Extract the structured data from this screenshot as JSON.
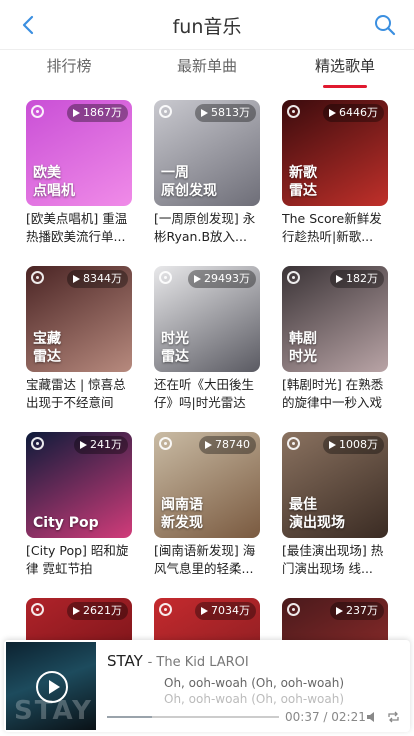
{
  "header": {
    "title": "fun音乐",
    "back_icon": "back-arrow-icon",
    "search_icon": "search-icon",
    "accent": "#3b8fe0"
  },
  "tabs": [
    {
      "label": "排行榜",
      "active": false
    },
    {
      "label": "最新单曲",
      "active": false
    },
    {
      "label": "精选歌单",
      "active": true
    }
  ],
  "accent_color": "#e0192f",
  "playlists": [
    {
      "plays": "1867万",
      "overlay": "欧美\n点唱机",
      "caption": "[欧美点唱机] 重温热播欧美流行单...",
      "colors": [
        "#c94fd6",
        "#f08be8"
      ]
    },
    {
      "plays": "5813万",
      "overlay": "一周\n原创发现",
      "caption": "[一周原创发现] 永彬Ryan.B放入...",
      "colors": [
        "#c9c9cf",
        "#6e6e78"
      ]
    },
    {
      "plays": "6446万",
      "overlay": "新歌\n雷达",
      "caption": "The Score新鲜发行趁热听|新歌...",
      "colors": [
        "#3a0b0d",
        "#c0302a"
      ]
    },
    {
      "plays": "8344万",
      "overlay": "宝藏\n雷达",
      "caption": "宝藏雷达 | 惊喜总出现于不经意间",
      "colors": [
        "#4a2424",
        "#b78a7e"
      ]
    },
    {
      "plays": "29493万",
      "overlay": "时光\n雷达",
      "caption": "还在听《大田後生仔》吗|时光雷达",
      "colors": [
        "#e8e8ea",
        "#5a5a62"
      ]
    },
    {
      "plays": "182万",
      "overlay": "韩剧\n时光",
      "caption": "[韩剧时光] 在熟悉的旋律中一秒入戏",
      "colors": [
        "#3a3336",
        "#b9a4a6"
      ]
    },
    {
      "plays": "241万",
      "overlay": "City Pop",
      "caption": "[City Pop] 昭和旋律 霓虹节拍",
      "colors": [
        "#0d1b3a",
        "#d13c7a"
      ]
    },
    {
      "plays": "78740",
      "overlay": "闽南语\n新发现",
      "caption": "[闽南语新发现] 海风气息里的轻柔...",
      "colors": [
        "#c9bba4",
        "#7a5a40"
      ]
    },
    {
      "plays": "1008万",
      "overlay": "最佳\n演出现场",
      "caption": "[最佳演出现场] 热门演出现场 线...",
      "colors": [
        "#8a7260",
        "#3a2b23"
      ]
    },
    {
      "plays": "2621万",
      "overlay": "",
      "caption": "",
      "colors": [
        "#b0232a",
        "#6a1014"
      ]
    },
    {
      "plays": "7034万",
      "overlay": "",
      "caption": "",
      "colors": [
        "#c52a2e",
        "#7a1a1e"
      ]
    },
    {
      "plays": "237万",
      "overlay": "",
      "caption": "",
      "colors": [
        "#4a1a1c",
        "#a0302e"
      ]
    }
  ],
  "player": {
    "song": "STAY",
    "artist": "- The Kid LAROI",
    "lyric_current": "Oh, ooh-woah (Oh, ooh-woah)",
    "lyric_next": "Oh, ooh-woah (Oh, ooh-woah)",
    "current_time": "00:37",
    "total_time": "02:21",
    "time_display": "00:37 / 02:21",
    "cover_text": "STAY",
    "progress": 0.26
  }
}
